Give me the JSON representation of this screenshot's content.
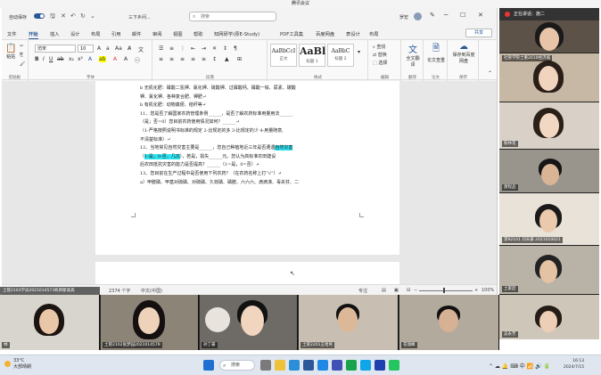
{
  "meeting": {
    "title": "腾讯会议"
  },
  "word": {
    "autosave_label": "自动保存",
    "doc_title": "三下乡问...",
    "search_placeholder": "搜索",
    "user_name": "罗宏",
    "tabs": [
      "文件",
      "开始",
      "插入",
      "设计",
      "布局",
      "引用",
      "邮件",
      "审阅",
      "视图",
      "帮助",
      "知网研学(原E-Study)",
      "PDF工具集",
      "百度网盘",
      "表设计",
      "布局"
    ],
    "share_label": "共享",
    "ribbon": {
      "paste_label": "粘贴",
      "clipboard_group": "剪贴板",
      "font_name": "仿宋",
      "font_size": "10",
      "font_group": "字体",
      "paragraph_group": "段落",
      "styles": [
        {
          "sample": "AaBbCcI",
          "name": "正文"
        },
        {
          "sample": "AaBl",
          "name": "标题 1"
        },
        {
          "sample": "AaBbC",
          "name": "标题 2"
        }
      ],
      "styles_group": "样式",
      "find_label": "查找",
      "replace_label": "替换",
      "select_label": "选择",
      "editing_group": "编辑",
      "translate_label": "全文翻译",
      "translate_group": "翻译",
      "paper_check_label": "论文查重",
      "paper_group": "论文",
      "save_netdisk_label": "保存到百度网盘",
      "save_group": "保存"
    },
    "document_lines": [
      "b 无机化肥：磷酸二氢钾、氯化钾、硫酸钾、过磷酸钙、磷酸一铵、尿素、碳酸",
      "钾、氯化钾、各种复合肥、钾肥↵",
      "b 有机化肥：动物粪便、秸秆等↵",
      "11、您是否了解国家农药管理条例______，是否了解农药标准用量用法______",
      "（是；否=0）您目前农药使用情况如何？______↵",
      "（1-严格按照说明书标准的规定    2-比规定的多    3-比规定的少    4-用量随意,",
      "不清楚标准）↵"
    ],
    "q12_part1": "12、当地常见自然灾害主要是______，您自己种植地近三年是否遭遇",
    "q12_hl1": "自然灾害",
    "q12_part2a": "（",
    "q12_hl2": "1-是，0-否，几次",
    "q12_part2b": "），若是，损失______元。您认为高标准农田建设",
    "q12_part3": "后农田抵抗灾害的能力是否提高？______（1=是，0=否）↵",
    "q13": "13、您目前在生产过程中是否使用下列农药？（在农药名称上打“√”）↵",
    "q13_options": "a）甲胺磷、甲基对硫磷、对硫磷、久效磷、磷胺、六六六、滴滴涕、毒杀芬、二",
    "status": {
      "page_info": "第 4 页，共 5 页",
      "word_count": "2374 个字",
      "language": "中文(中国)",
      "focus": "专注",
      "zoom": "100%"
    }
  },
  "participants_right": [
    {
      "name": "正在讲话：施二",
      "label": ""
    },
    {
      "name": "社管学院士重2010经济城",
      "label": ""
    },
    {
      "name": "粉林花",
      "label": ""
    },
    {
      "name": "唐程品",
      "label": ""
    },
    {
      "name": "李92101 刘天豪 2021010021",
      "label": ""
    },
    {
      "name": "土家后",
      "label": ""
    },
    {
      "name": "吴永芳",
      "label": ""
    }
  ],
  "strip_caption": "土管2103学员2021014573机师斯高高",
  "participants_bottom": [
    {
      "name": "林"
    },
    {
      "name": "土管2102张梦园2021014579"
    },
    {
      "name": "孙丁豪"
    },
    {
      "name": "土管2201王哈男"
    },
    {
      "name": "花瑞峰"
    },
    {
      "name": ""
    }
  ],
  "taskbar": {
    "temp": "33°C",
    "weather": "大部晴朗",
    "search_label": "搜索",
    "time": "16:13",
    "date": "2024/7/15"
  },
  "colors": {
    "word_blue": "#2b579a",
    "highlight": "#2ee4f2",
    "record_red": "#e33333"
  }
}
